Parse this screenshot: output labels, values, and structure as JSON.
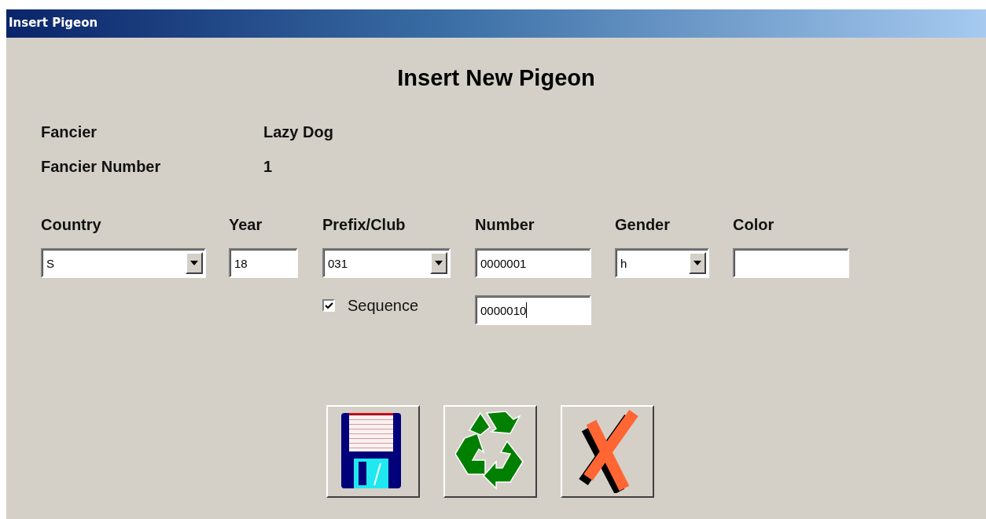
{
  "window": {
    "title": "Insert Pigeon"
  },
  "heading": "Insert New Pigeon",
  "info": [
    {
      "label": "Fancier",
      "value": "Lazy Dog"
    },
    {
      "label": "Fancier Number",
      "value": "1"
    }
  ],
  "fields": [
    {
      "label": "Country",
      "kind": "combo",
      "value": "S"
    },
    {
      "label": "Year",
      "kind": "text",
      "value": "18"
    },
    {
      "label": "Prefix/Club",
      "kind": "combo",
      "value": "031"
    },
    {
      "label": "Number",
      "kind": "text",
      "value": "0000001"
    },
    {
      "label": "Gender",
      "kind": "combo",
      "value": "h"
    },
    {
      "label": "Color",
      "kind": "text"
    }
  ],
  "sequence": {
    "label": "Sequence",
    "checked": true,
    "value": "0000010",
    "focused": true
  },
  "buttons": [
    {
      "kind": "save"
    },
    {
      "kind": "recycle"
    },
    {
      "kind": "cancel"
    }
  ]
}
